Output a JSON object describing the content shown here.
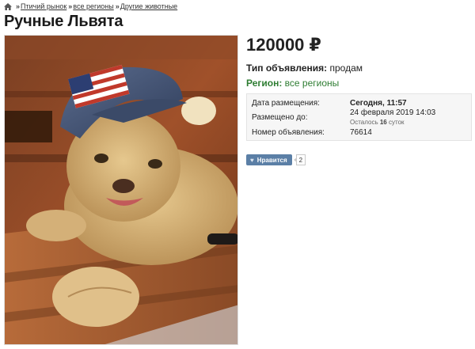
{
  "breadcrumb": {
    "items": [
      "Птичий рынок",
      "все регионы",
      "Другие животные"
    ],
    "separator": "»"
  },
  "listing": {
    "title": "Ручные Львята",
    "price": "120000 ₽",
    "type_label": "Тип объявления:",
    "type_value": "продам",
    "region_label": "Регион:",
    "region_value": "все регионы"
  },
  "info": {
    "posted_label": "Дата размещения:",
    "posted_value": "Сегодня, 11:57",
    "until_label": "Размещено до:",
    "until_value": "24 февраля 2019 14:03",
    "remaining_prefix": "Осталось",
    "remaining_days": "16",
    "remaining_suffix": "суток",
    "number_label": "Номер объявления:",
    "number_value": "76614"
  },
  "like": {
    "label": "Нравится",
    "count": "2"
  },
  "icons": {
    "home": "home-icon",
    "heart": "heart-icon"
  },
  "colors": {
    "region_green": "#2e7d32",
    "like_button": "#5b7fa6"
  }
}
